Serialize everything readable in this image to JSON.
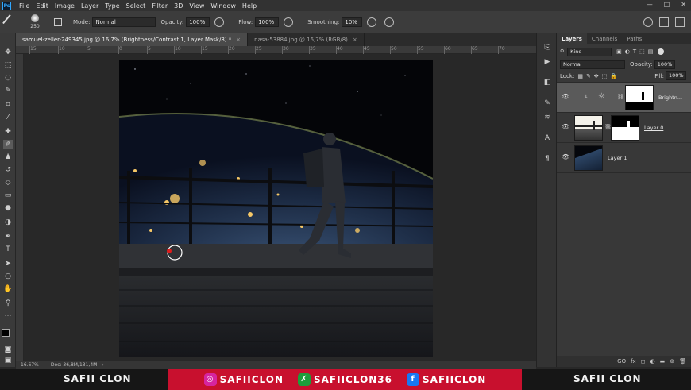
{
  "menu": [
    "File",
    "Edit",
    "Image",
    "Layer",
    "Type",
    "Select",
    "Filter",
    "3D",
    "View",
    "Window",
    "Help"
  ],
  "app_badge": "Ps",
  "window_controls": [
    "—",
    "□",
    "✕"
  ],
  "options": {
    "brush_size": "250",
    "mode_label": "Mode:",
    "mode_value": "Normal",
    "opacity_label": "Opacity:",
    "opacity_value": "100%",
    "flow_label": "Flow:",
    "flow_value": "100%",
    "smoothing_label": "Smoothing:",
    "smoothing_value": "10%"
  },
  "tabs": [
    {
      "label": "samuel-zeller-249345.jpg @ 16,7% (Brightness/Contrast 1, Layer Mask/8) *",
      "close": "×"
    },
    {
      "label": "nasa-53884.jpg @ 16,7% (RGB/8)",
      "close": "×"
    }
  ],
  "ruler_ticks": [
    "15",
    "10",
    "5",
    "0",
    "5",
    "10",
    "15",
    "20",
    "25",
    "30",
    "35",
    "40",
    "45",
    "50",
    "55",
    "60",
    "65",
    "70"
  ],
  "status": {
    "zoom": "16.67%",
    "doc": "Doc: 36,8M/131,4M",
    "arrow": "›"
  },
  "layers_panel": {
    "tabs": [
      "Layers",
      "Channels",
      "Paths"
    ],
    "kind": "Kind",
    "blend": "Normal",
    "opacity_label": "Opacity:",
    "opacity_value": "100%",
    "lock_label": "Lock:",
    "fill_label": "Fill:",
    "fill_value": "100%",
    "layers": [
      {
        "name": "Brightn...",
        "active": true
      },
      {
        "name": "Layer 0",
        "active": false
      },
      {
        "name": "Layer 1",
        "active": false
      }
    ],
    "footer_icons": [
      "GO",
      "fx",
      "◻",
      "◐",
      "▬",
      "⊕",
      "🗑"
    ]
  },
  "banner": {
    "left": "SAFII CLON",
    "right": "SAFII CLON",
    "items": [
      {
        "platform": "instagram-icon",
        "text": "SAFIICLON",
        "color": "#d6249f"
      },
      {
        "platform": "green-icon",
        "text": "SAFIICLON36",
        "color": "#1d9d3b"
      },
      {
        "platform": "facebook-icon",
        "text": "SAFIICLON",
        "color": "#1877f2"
      }
    ]
  }
}
